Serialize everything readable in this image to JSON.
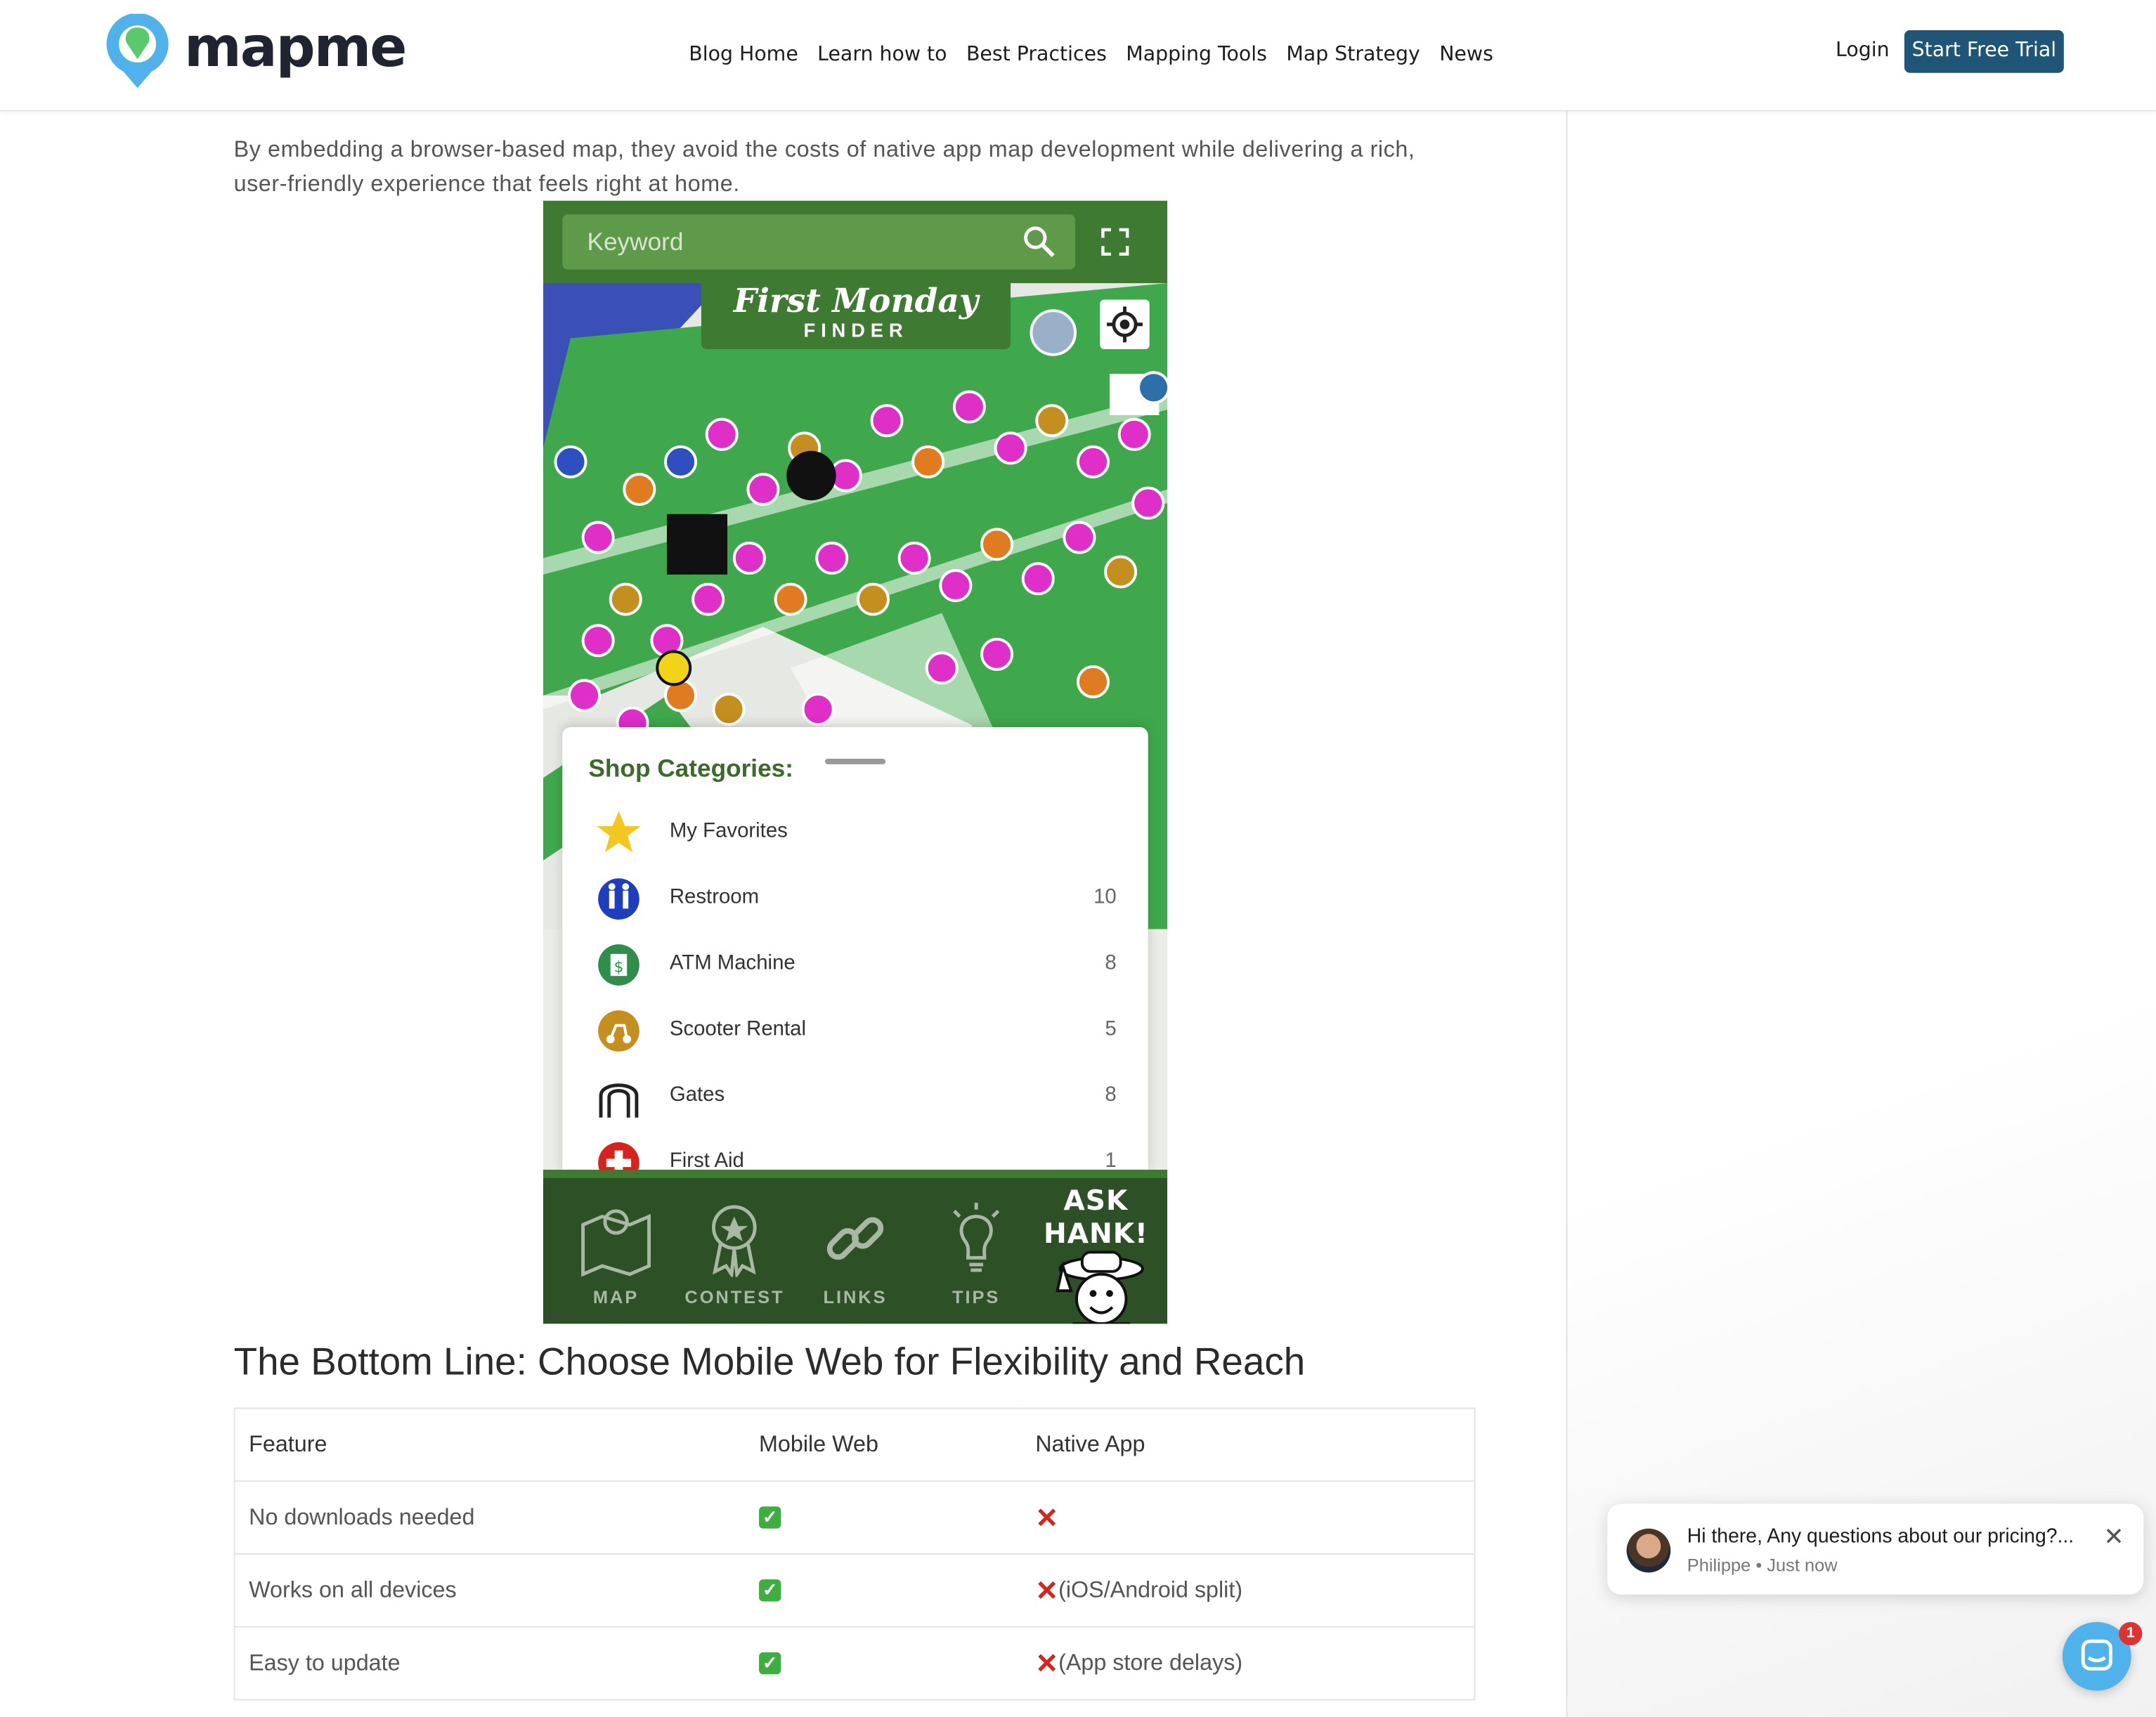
{
  "header": {
    "logo_text": "mapme",
    "nav": [
      {
        "label": "Blog Home"
      },
      {
        "label": "Learn how to"
      },
      {
        "label": "Best Practices"
      },
      {
        "label": "Mapping Tools"
      },
      {
        "label": "Map Strategy"
      },
      {
        "label": "News"
      }
    ],
    "login_label": "Login",
    "trial_label": "Start Free Trial"
  },
  "article": {
    "intro": "By embedding a browser-based map, they avoid the costs of native app map development while delivering a rich, user-friendly experience that feels right at home.",
    "heading": "The Bottom Line: Choose Mobile Web for Flexibility and Reach"
  },
  "app_screenshot": {
    "search_placeholder": "Keyword",
    "brand_line1": "First Monday",
    "brand_line2": "FINDER",
    "panel_title": "Shop Categories:",
    "categories": [
      {
        "label": "My Favorites",
        "count": "",
        "icon": "star-icon",
        "color": "#f2c81e"
      },
      {
        "label": "Restroom",
        "count": "10",
        "icon": "restroom-icon",
        "color": "#1d3fbf"
      },
      {
        "label": "ATM Machine",
        "count": "8",
        "icon": "atm-icon",
        "color": "#2f8f4a"
      },
      {
        "label": "Scooter Rental",
        "count": "5",
        "icon": "scooter-icon",
        "color": "#c58f1f"
      },
      {
        "label": "Gates",
        "count": "8",
        "icon": "gate-icon",
        "color": "#222222"
      },
      {
        "label": "First Aid",
        "count": "1",
        "icon": "first-aid-icon",
        "color": "#d9221c"
      }
    ],
    "tabs": [
      {
        "label": "MAP",
        "icon": "map-icon"
      },
      {
        "label": "CONTEST",
        "icon": "ribbon-icon"
      },
      {
        "label": "LINKS",
        "icon": "link-icon"
      },
      {
        "label": "TIPS",
        "icon": "lightbulb-icon"
      }
    ],
    "ask_label": "ASK HANK!"
  },
  "table": {
    "headers": [
      "Feature",
      "Mobile Web",
      "Native App"
    ],
    "rows": [
      {
        "feature": "No downloads needed",
        "native_note": ""
      },
      {
        "feature": "Works on all devices",
        "native_note": "(iOS/Android split)"
      },
      {
        "feature": "Easy to update",
        "native_note": "(App store delays)"
      }
    ]
  },
  "chat": {
    "message": "Hi there, Any questions about our pricing?...",
    "meta": "Philippe • Just now",
    "badge": "1"
  },
  "colors": {
    "brand_blue": "#1f5677",
    "app_green": "#3f7a32",
    "check_green": "#3fae41",
    "cross_red": "#d9221c"
  }
}
